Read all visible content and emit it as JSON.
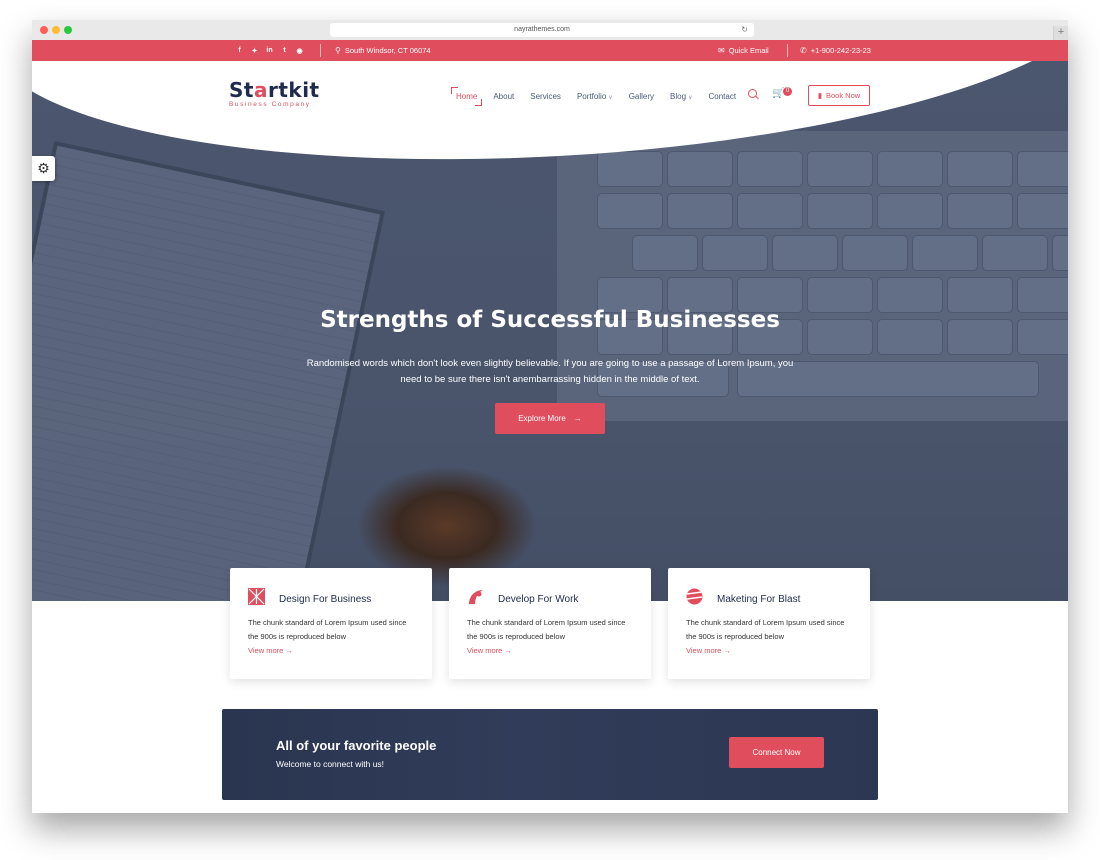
{
  "browser": {
    "url": "nayrathemes.com"
  },
  "topbar": {
    "social_icons": [
      "facebook-icon",
      "twitter-icon",
      "linkedin-icon",
      "tumblr-icon",
      "pinterest-icon"
    ],
    "location": "South Windsor, CT 06074",
    "email_label": "Quick Email",
    "phone": "+1-900-242-23-23"
  },
  "header": {
    "logo_text_start": "St",
    "logo_text_accent": "a",
    "logo_text_end": "rtkit",
    "logo_tagline": "Business Company",
    "nav": [
      {
        "label": "Home",
        "active": true,
        "dropdown": false
      },
      {
        "label": "About",
        "active": false,
        "dropdown": false
      },
      {
        "label": "Services",
        "active": false,
        "dropdown": false
      },
      {
        "label": "Portfolio",
        "active": false,
        "dropdown": true
      },
      {
        "label": "Gallery",
        "active": false,
        "dropdown": false
      },
      {
        "label": "Blog",
        "active": false,
        "dropdown": true
      },
      {
        "label": "Contact",
        "active": false,
        "dropdown": false
      }
    ],
    "cart_count": "0",
    "book_button": "Book Now"
  },
  "hero": {
    "title": "Strengths of Successful Businesses",
    "text": "Randomised words which don't look even slightly believable. If you are going to use a passage of Lorem Ipsum, you need to be sure there isn't anembarrassing hidden in the middle of text.",
    "button": "Explore More"
  },
  "features": [
    {
      "title": "Design For Business",
      "text": "The chunk standard of Lorem Ipsum used since the 900s is reproduced below",
      "link": "View more",
      "icon": "design-icon"
    },
    {
      "title": "Develop For Work",
      "text": "The chunk standard of Lorem Ipsum used since the 900s is reproduced below",
      "link": "View more",
      "icon": "develop-icon"
    },
    {
      "title": "Maketing For Blast",
      "text": "The chunk standard of Lorem Ipsum used since the 900s is reproduced below",
      "link": "View more",
      "icon": "marketing-icon"
    }
  ],
  "cta": {
    "title": "All of your favorite people",
    "subtitle": "Welcome to connect with us!",
    "button": "Connect Now"
  },
  "colors": {
    "accent": "#e04e5e",
    "navy": "#1f2b4d",
    "hero_overlay": "#4b566f"
  }
}
